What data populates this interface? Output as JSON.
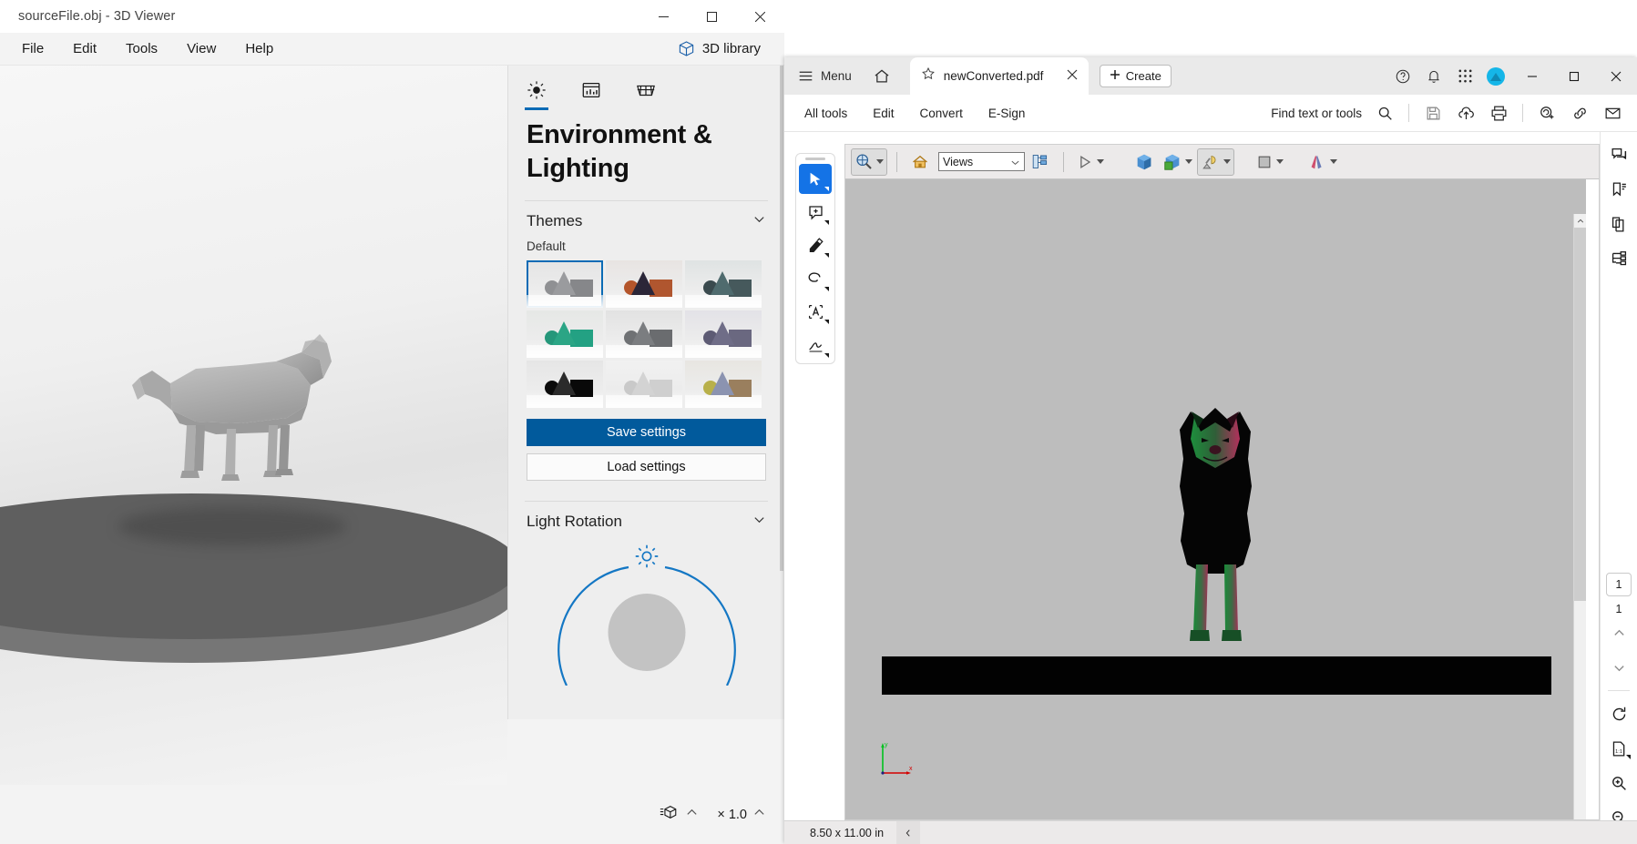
{
  "viewer": {
    "title": "sourceFile.obj - 3D Viewer",
    "window_controls": [
      {
        "name": "minimize-button",
        "glyph": "minimize-icon"
      },
      {
        "name": "maximize-button",
        "glyph": "maximize-icon"
      },
      {
        "name": "close-button",
        "glyph": "close-icon"
      }
    ],
    "menus": [
      "File",
      "Edit",
      "Tools",
      "View",
      "Help"
    ],
    "library_button": "3D library",
    "panel": {
      "tabs": [
        "lighting-icon",
        "chart-icon",
        "grid-icon"
      ],
      "active_tab_index": 0,
      "heading": "Environment & Lighting",
      "themes_section": {
        "title": "Themes",
        "subtitle": "Default",
        "selected_index": 0,
        "thumbs": [
          {
            "name": "theme-grey",
            "sphere": "#8f9093",
            "cone": "#9a9b9e",
            "box": "#86878a",
            "bg": "#e4e4e4"
          },
          {
            "name": "theme-sunset",
            "sphere": "#b4552b",
            "cone": "#2b2638",
            "box": "#b0562f",
            "bg": "#e8e4e2"
          },
          {
            "name": "theme-teal-dark",
            "sphere": "#3a4a4e",
            "cone": "#4f6b6e",
            "box": "#46595c",
            "bg": "#dfe3e3"
          },
          {
            "name": "theme-green",
            "sphere": "#25977a",
            "cone": "#2ba585",
            "box": "#23a183",
            "bg": "#e6e8e6"
          },
          {
            "name": "theme-slate",
            "sphere": "#6f7174",
            "cone": "#7b7d80",
            "box": "#6a6c6f",
            "bg": "#e2e2e2"
          },
          {
            "name": "theme-violet",
            "sphere": "#5d5b74",
            "cone": "#6f6d87",
            "box": "#6a6880",
            "bg": "#e3e2e7"
          },
          {
            "name": "theme-black",
            "sphere": "#0b0b0b",
            "cone": "#2b2b2b",
            "box": "#090909",
            "bg": "#e6e6e6"
          },
          {
            "name": "theme-white",
            "sphere": "#c9c9c9",
            "cone": "#d3d3d3",
            "box": "#cfcfcf",
            "bg": "#f1f1f1"
          },
          {
            "name": "theme-colorful",
            "sphere": "#b8b04a",
            "cone": "#8b93b0",
            "box": "#9a7f5e",
            "bg": "#e8e6e1"
          }
        ]
      },
      "save_label": "Save settings",
      "load_label": "Load settings",
      "light_rotation": {
        "title": "Light Rotation",
        "sun_icon": "sun-icon"
      }
    },
    "statusbar": {
      "model_icon": "model-units-icon",
      "model_caret": "chevron-up-icon",
      "zoom_label": "× 1.0",
      "zoom_caret": "chevron-up-icon"
    }
  },
  "acrobat": {
    "tabbar": {
      "menu_label": "Menu",
      "hamburger_icon": "hamburger-icon",
      "home_icon": "home-icon",
      "tab": {
        "star_icon": "star-icon",
        "name": "newConverted.pdf",
        "close_icon": "close-icon"
      },
      "create_label": "Create",
      "create_icon": "plus-icon",
      "right_icons": [
        "help-icon",
        "bell-icon",
        "apps-grid-icon",
        "account-avatar"
      ],
      "window_controls": [
        "minimize-icon",
        "maximize-icon",
        "close-icon"
      ]
    },
    "menurow": {
      "items": [
        "All tools",
        "Edit",
        "Convert",
        "E-Sign"
      ],
      "find_label": "Find text or tools",
      "find_icon": "search-icon",
      "right_icons": [
        "save-icon",
        "cloud-upload-icon",
        "print-icon",
        "add-person-icon",
        "link-icon",
        "email-icon"
      ]
    },
    "left_tools": [
      {
        "name": "select-tool",
        "icon": "cursor-arrow-icon",
        "active": true
      },
      {
        "name": "comment-tool",
        "icon": "comment-add-icon",
        "active": false
      },
      {
        "name": "highlight-tool",
        "icon": "highlighter-icon",
        "active": false
      },
      {
        "name": "draw-tool",
        "icon": "lasso-icon",
        "active": false
      },
      {
        "name": "edit-text-tool",
        "icon": "text-select-icon",
        "active": false
      },
      {
        "name": "sign-tool",
        "icon": "signature-icon",
        "active": false
      }
    ],
    "pdf3d_toolbar": {
      "rotate_tool_icon": "rotate-3d-icon",
      "home_icon": "default-view-home-icon",
      "views_value": "Views",
      "views_placeholder": "Views",
      "tree_icon": "model-tree-icon",
      "play_icon": "play-animation-icon",
      "cube_icon": "use-perspective-cube-icon",
      "parts_icon": "cross-section-icon",
      "light_icon": "lighting-lamp-icon",
      "bg_icon": "background-color-icon",
      "render_icon": "render-mode-icon"
    },
    "right_rail": {
      "top_icons": [
        "comments-panel-icon",
        "bookmarks-panel-icon",
        "page-thumbnails-icon",
        "model-tree-panel-icon"
      ],
      "page_current": "1",
      "page_total": "1",
      "prev_icon": "chevron-up-icon",
      "next_icon": "chevron-down-icon",
      "bottom_icons": [
        "rotate-page-icon",
        "fit-page-icon",
        "zoom-in-icon",
        "zoom-out-icon"
      ]
    },
    "statusbar": {
      "dimensions": "8.50 x 11.00 in",
      "collapse_icon": "chevron-left-icon"
    },
    "canvas": {
      "axis_labels": {
        "y": "y",
        "x": "x"
      },
      "axis_colors": {
        "y": "#00c21e",
        "x": "#d40000"
      }
    }
  }
}
